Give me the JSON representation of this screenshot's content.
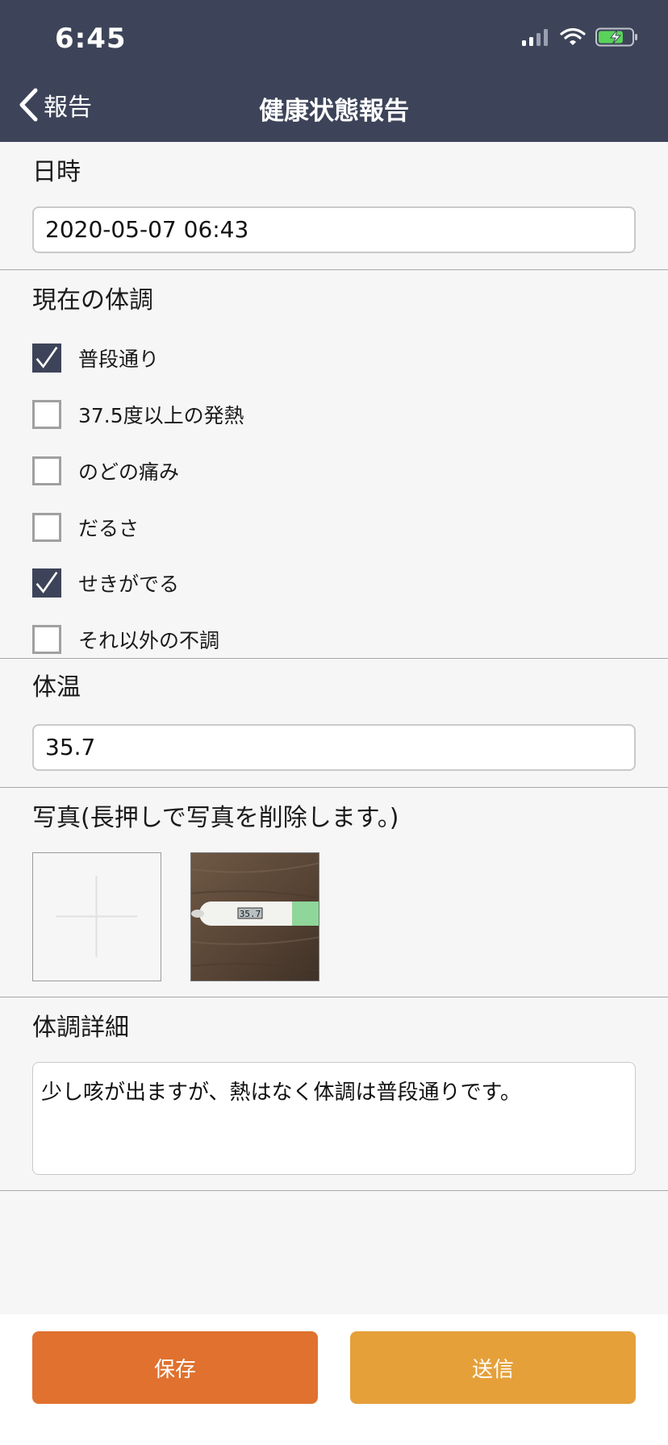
{
  "status_bar": {
    "time": "6:45"
  },
  "nav": {
    "back_label": "報告",
    "title": "健康状態報告"
  },
  "datetime": {
    "label": "日時",
    "value": "2020-05-07 06:43"
  },
  "condition": {
    "label": "現在の体調",
    "options": [
      {
        "label": "普段通り",
        "checked": true
      },
      {
        "label": "37.5度以上の発熱",
        "checked": false
      },
      {
        "label": "のどの痛み",
        "checked": false
      },
      {
        "label": "だるさ",
        "checked": false
      },
      {
        "label": "せきがでる",
        "checked": true
      },
      {
        "label": "それ以外の不調",
        "checked": false
      }
    ]
  },
  "temperature": {
    "label": "体温",
    "value": "35.7"
  },
  "photos": {
    "label": "写真(長押しで写真を削除します。)",
    "thermometer_reading": "35.7"
  },
  "details": {
    "label": "体調詳細",
    "value": "少し咳が出ますが、熱はなく体調は普段通りです。"
  },
  "buttons": {
    "save": "保存",
    "send": "送信"
  },
  "colors": {
    "header": "#3d4459",
    "save": "#e0712e",
    "send": "#e5a03a",
    "checkbox_on": "#3d4459"
  }
}
